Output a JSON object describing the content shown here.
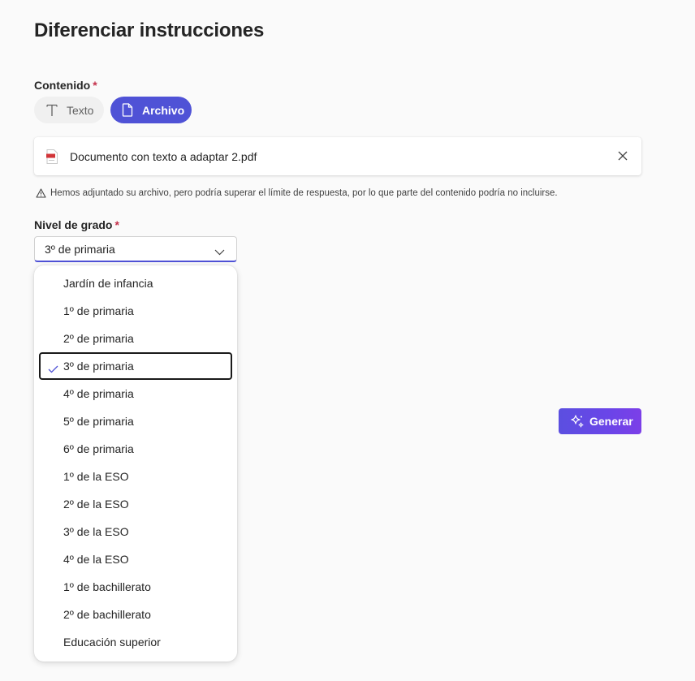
{
  "page": {
    "title": "Diferenciar instrucciones"
  },
  "content_field": {
    "label": "Contenido",
    "required_mark": "*",
    "options": {
      "texto": "Texto",
      "archivo": "Archivo"
    },
    "selected": "Archivo"
  },
  "file": {
    "name": "Documento con texto a adaptar 2.pdf",
    "icon": "pdf-file-icon"
  },
  "warning": {
    "text": "Hemos adjuntado su archivo, pero podría superar el límite de respuesta, por lo que parte del contenido podría no incluirse."
  },
  "grade_field": {
    "label": "Nivel de grado",
    "required_mark": "*",
    "value": "3º de primaria",
    "options": [
      "Jardín de infancia",
      "1º de primaria",
      "2º de primaria",
      "3º de primaria",
      "4º de primaria",
      "5º de primaria",
      "6º de primaria",
      "1º de la ESO",
      "2º de la ESO",
      "3º de la ESO",
      "4º de la ESO",
      "1º de bachillerato",
      "2º de bachillerato",
      "Educación superior"
    ],
    "selected_index": 3
  },
  "actions": {
    "generate_label": "Generar"
  },
  "colors": {
    "accent": "#4f52d6",
    "required": "#c4314b"
  }
}
